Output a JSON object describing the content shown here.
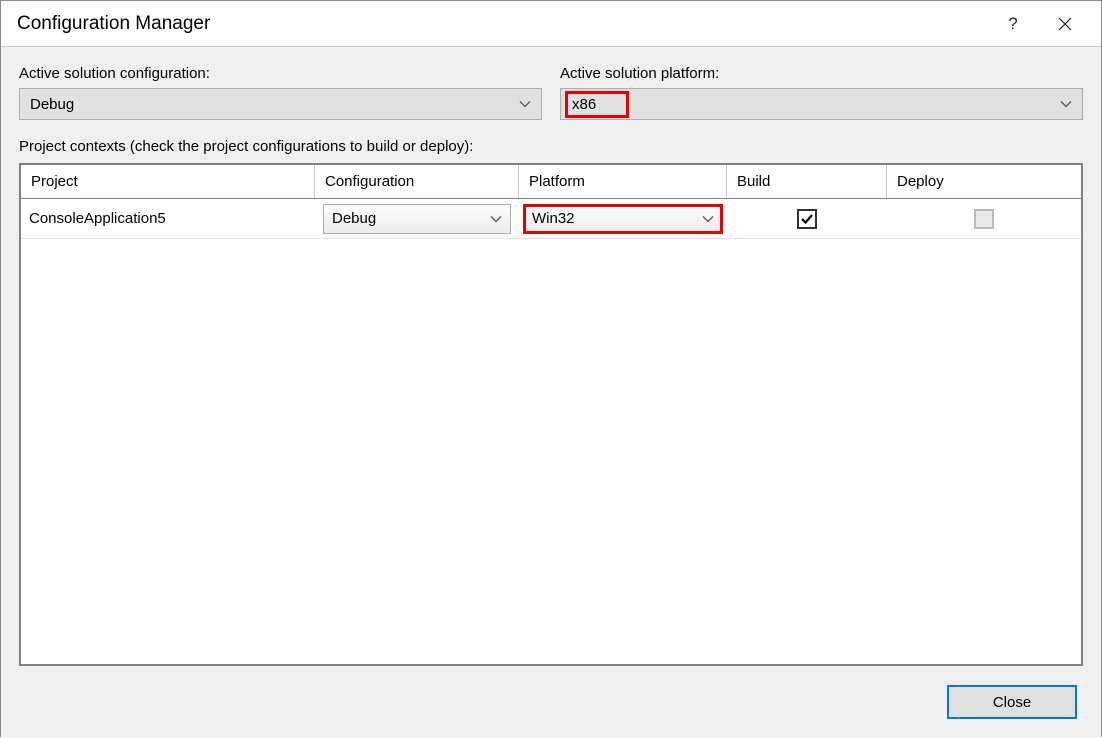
{
  "title": "Configuration Manager",
  "active_config": {
    "label": "Active solution configuration:",
    "value": "Debug"
  },
  "active_platform": {
    "label": "Active solution platform:",
    "value": "x86"
  },
  "contexts_label": "Project contexts (check the project configurations to build or deploy):",
  "columns": {
    "project": "Project",
    "configuration": "Configuration",
    "platform": "Platform",
    "build": "Build",
    "deploy": "Deploy"
  },
  "rows": [
    {
      "project": "ConsoleApplication5",
      "configuration": "Debug",
      "platform": "Win32",
      "build_checked": true,
      "deploy_enabled": false
    }
  ],
  "close_label": "Close"
}
